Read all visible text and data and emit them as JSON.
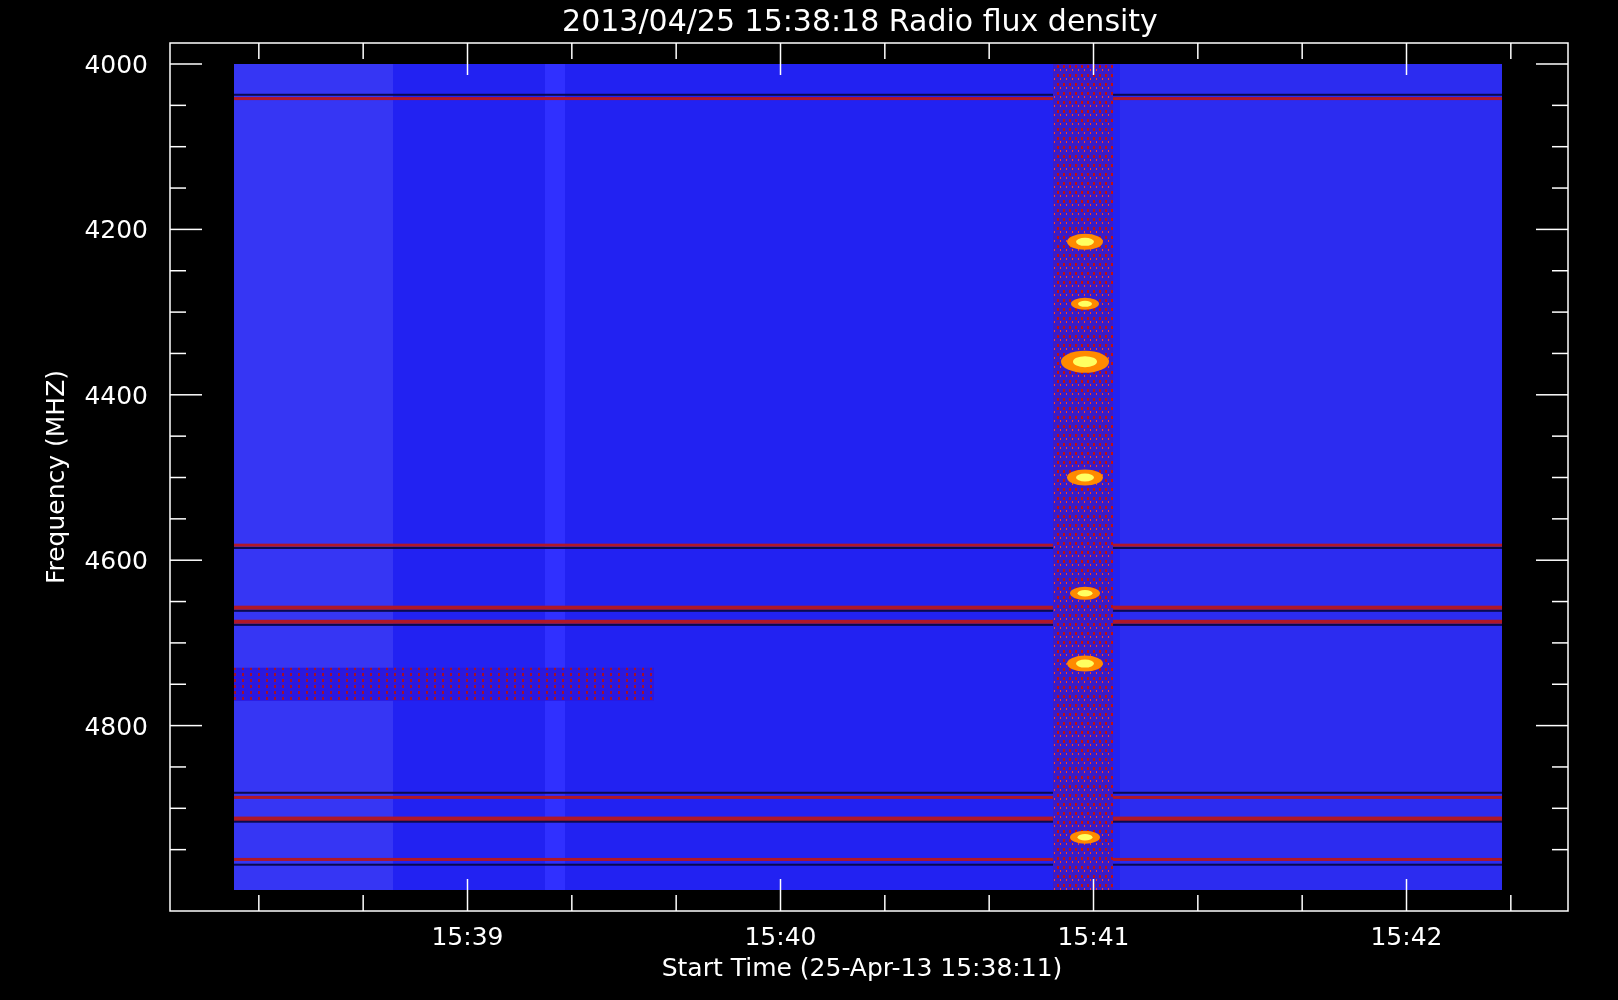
{
  "title": "2013/04/25 15:38:18 Radio flux density",
  "y_axis": {
    "label": "Frequency (MHZ)",
    "ticks": [
      "4000",
      "4200",
      "4400",
      "4600",
      "4800"
    ]
  },
  "x_axis": {
    "label": "Start Time (25-Apr-13 15:38:11)",
    "ticks": [
      "15:39",
      "15:40",
      "15:41",
      "15:42"
    ]
  }
}
